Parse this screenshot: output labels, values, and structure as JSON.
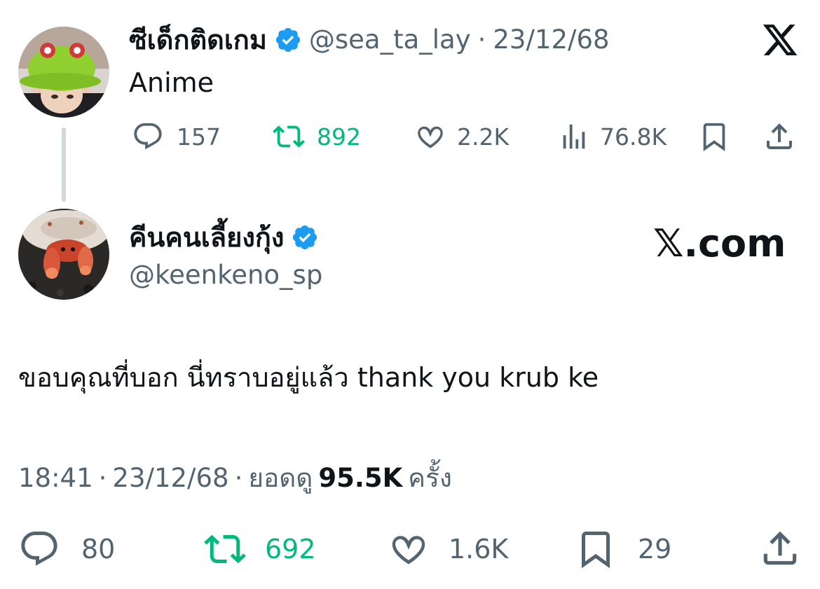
{
  "quoted_tweet": {
    "display_name": "ซีเด็กติดเกม",
    "handle": "@sea_ta_lay",
    "separator": "·",
    "date": "23/12/68",
    "text": "Anime",
    "replies": "157",
    "retweets": "892",
    "likes": "2.2K",
    "views": "76.8K"
  },
  "brand": {
    "logo_text": "𝕏",
    "watermark": "𝕏.com"
  },
  "main_tweet": {
    "display_name": "คีนคนเลี้ยงกุ้ง",
    "handle": "@keenkeno_sp",
    "text": "ขอบคุณที่บอก นี่ทราบอยู่แล้ว thank you krub ke",
    "time": "18:41",
    "separator": "·",
    "date": "23/12/68",
    "views_label": "ยอดดู",
    "views_count": "95.5K",
    "views_suffix": "ครั้ง",
    "replies": "80",
    "retweets": "692",
    "likes": "1.6K",
    "bookmarks": "29"
  },
  "colors": {
    "text": "#0f1419",
    "muted": "#536471",
    "retweet_green": "#00ba7c",
    "verified_blue": "#1d9bf0",
    "thread_line": "#cfd9de"
  },
  "icons": [
    "reply-icon",
    "retweet-icon",
    "like-icon",
    "views-icon",
    "bookmark-icon",
    "share-icon",
    "verified-badge-icon",
    "x-logo-icon"
  ]
}
